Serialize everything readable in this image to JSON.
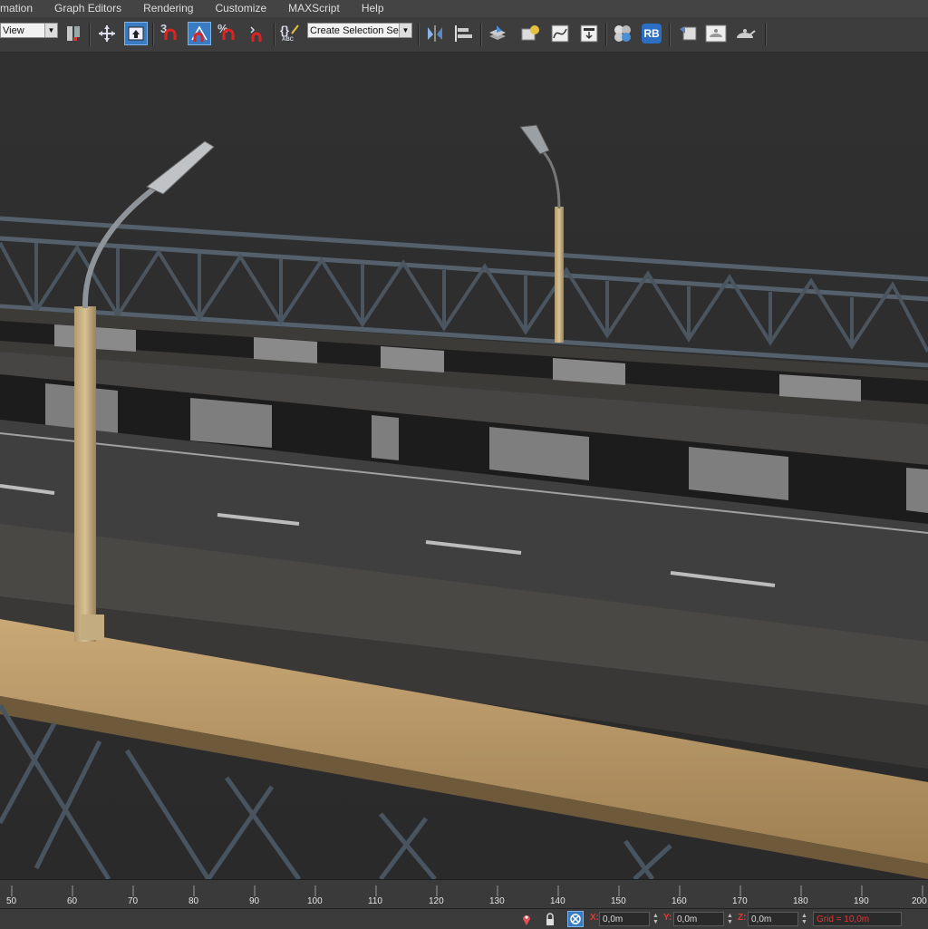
{
  "menu": [
    "mation",
    "Graph Editors",
    "Rendering",
    "Customize",
    "MAXScript",
    "Help"
  ],
  "toolbar": {
    "view_dropdown": "View",
    "selection_set_dropdown": "Create Selection Se",
    "snap_3_label": "3",
    "percent_snap_label": "%",
    "edit_named_sets_label": "ABC",
    "rb_label": "RB"
  },
  "timeline": {
    "ticks": [
      "50",
      "60",
      "70",
      "80",
      "90",
      "100",
      "110",
      "120",
      "130",
      "140",
      "150",
      "160",
      "170",
      "180",
      "190",
      "200"
    ]
  },
  "status": {
    "x_label": "X:",
    "y_label": "Y:",
    "z_label": "Z:",
    "x_value": "0,0m",
    "y_value": "0,0m",
    "z_value": "0,0m",
    "grid_text": "Grid = 10,0m"
  },
  "colors": {
    "active_button": "#3a7cc4",
    "axis_label_red": "#ee3333",
    "viewport_bg": "#2d2d2d"
  }
}
